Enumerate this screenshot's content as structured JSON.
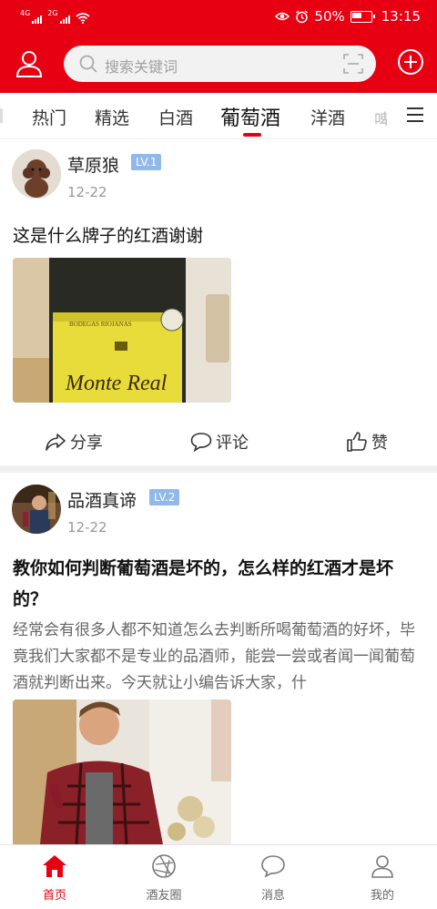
{
  "status_bar": {
    "signal1": "4G",
    "signal2": "2G",
    "battery": "50%",
    "time": "13:15",
    "icons": [
      "eye-icon",
      "alarm-icon",
      "battery-icon",
      "wifi-icon"
    ]
  },
  "header": {
    "search_placeholder": "搜索关键词",
    "icons": [
      "user-icon",
      "search-icon",
      "scan-icon",
      "plus-icon"
    ]
  },
  "tabs": [
    {
      "label": "热门"
    },
    {
      "label": "精选"
    },
    {
      "label": "白酒"
    },
    {
      "label": "葡萄酒",
      "active": true
    },
    {
      "label": "洋酒"
    },
    {
      "label": "啤"
    }
  ],
  "posts": [
    {
      "username": "草原狼",
      "level": "LV.1",
      "date": "12-22",
      "title": "这是什么牌子的红酒谢谢",
      "photo_labels": {
        "brand": "Monte Real",
        "bodega": "BODEGAS RIOJANAS"
      },
      "actions": {
        "share": "分享",
        "comment": "评论",
        "like": "赞"
      }
    },
    {
      "username": "品酒真谛",
      "level": "LV.2",
      "date": "12-22",
      "title": "教你如何判断葡萄酒是坏的，怎么样的红酒才是坏的？",
      "excerpt": "经常会有很多人都不知道怎么去判断所喝葡萄酒的好坏，毕竟我们大家都不是专业的品酒师，能尝一尝或者闻一闻葡萄酒就判断出来。今天就让小编告诉大家，什"
    }
  ],
  "bottom_nav": [
    {
      "label": "首页",
      "icon": "home-icon",
      "active": true
    },
    {
      "label": "酒友圈",
      "icon": "aperture-icon"
    },
    {
      "label": "消息",
      "icon": "chat-icon"
    },
    {
      "label": "我的",
      "icon": "person-icon"
    }
  ],
  "colors": {
    "brand_red": "#e60012",
    "level_badge": "#90b8ea"
  }
}
